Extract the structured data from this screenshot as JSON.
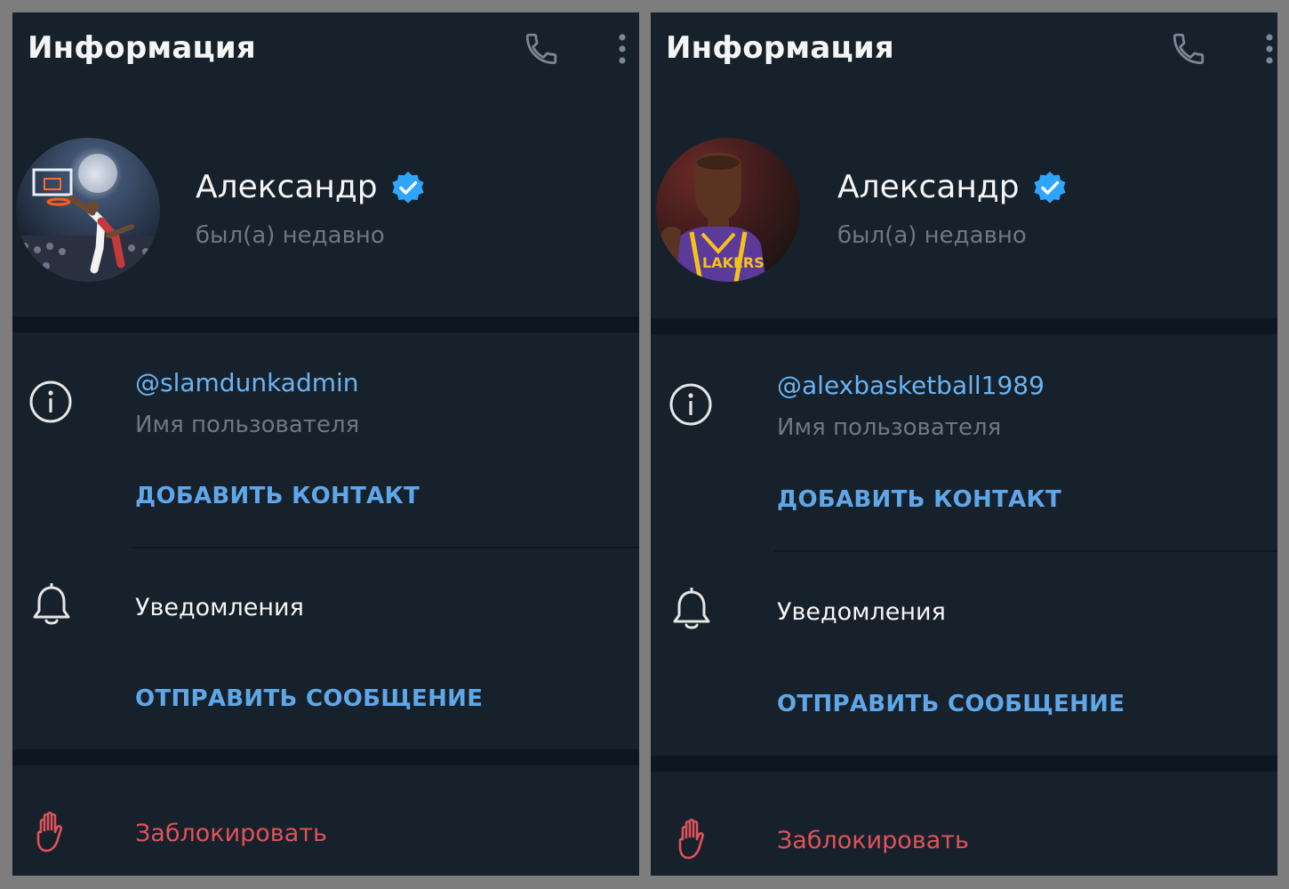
{
  "colors": {
    "background": "#17212b",
    "section_divider": "#0e1621",
    "title_text": "#f5f5f5",
    "muted_text": "#6d7883",
    "link": "#6ab3f3",
    "action": "#5fa7e8",
    "danger": "#e0525a",
    "verified_badge": "#2ea6ff"
  },
  "panels": [
    {
      "header": {
        "title": "Информация",
        "icons": [
          "phone-icon",
          "more-vertical-icon"
        ]
      },
      "profile": {
        "avatar_description": "basketball-dunk-photo",
        "name": "Александр",
        "verified_icon": "verified-badge-icon",
        "status": "был(а) недавно"
      },
      "info": {
        "icon": "info-icon",
        "username": "@slamdunkadmin",
        "username_label": "Имя пользователя",
        "add_contact": "ДОБАВИТЬ КОНТАКТ"
      },
      "notifications": {
        "icon": "bell-icon",
        "label": "Уведомления",
        "send_message": "ОТПРАВИТЬ СООБЩЕНИЕ"
      },
      "block": {
        "icon": "hand-stop-icon",
        "label": "Заблокировать"
      }
    },
    {
      "header": {
        "title": "Информация",
        "icons": [
          "phone-icon",
          "more-vertical-icon"
        ]
      },
      "profile": {
        "avatar_description": "basketball-player-lakers-24-photo",
        "name": "Александр",
        "verified_icon": "verified-badge-icon",
        "status": "был(а) недавно"
      },
      "info": {
        "icon": "info-icon",
        "username": "@alexbasketball1989",
        "username_label": "Имя пользователя",
        "add_contact": "ДОБАВИТЬ КОНТАКТ"
      },
      "notifications": {
        "icon": "bell-icon",
        "label": "Уведомления",
        "send_message": "ОТПРАВИТЬ СООБЩЕНИЕ"
      },
      "block": {
        "icon": "hand-stop-icon",
        "label": "Заблокировать"
      }
    }
  ]
}
